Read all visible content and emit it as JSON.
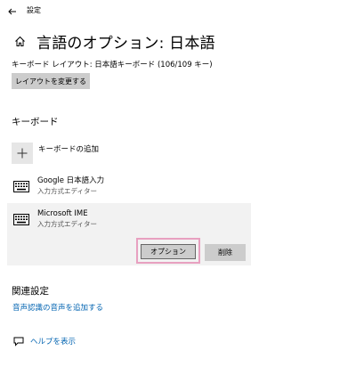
{
  "window": {
    "title": "設定"
  },
  "header": {
    "title": "言語のオプション: 日本語"
  },
  "layout": {
    "label": "キーボード レイアウト: 日本語キーボード (106/109 キー)",
    "change_button": "レイアウトを変更する"
  },
  "keyboard": {
    "heading": "キーボード",
    "add_label": "キーボードの追加",
    "items": [
      {
        "name": "Google 日本語入力",
        "subtitle": "入力方式エディター"
      },
      {
        "name": "Microsoft IME",
        "subtitle": "入力方式エディター"
      }
    ],
    "options_button": "オプション",
    "remove_button": "削除"
  },
  "related": {
    "heading": "関連設定",
    "link": "音声認識の音声を追加する"
  },
  "help": {
    "link": "ヘルプを表示"
  },
  "icons": {
    "back": "back-arrow-icon",
    "home": "home-icon",
    "add": "plus-icon",
    "keyboard": "keyboard-icon",
    "help": "help-chat-icon"
  },
  "colors": {
    "accent_link": "#0063b1",
    "button_gray": "#cccccc",
    "highlight_frame": "#e8a0c0",
    "selected_item_bg": "#f2f2f2"
  }
}
